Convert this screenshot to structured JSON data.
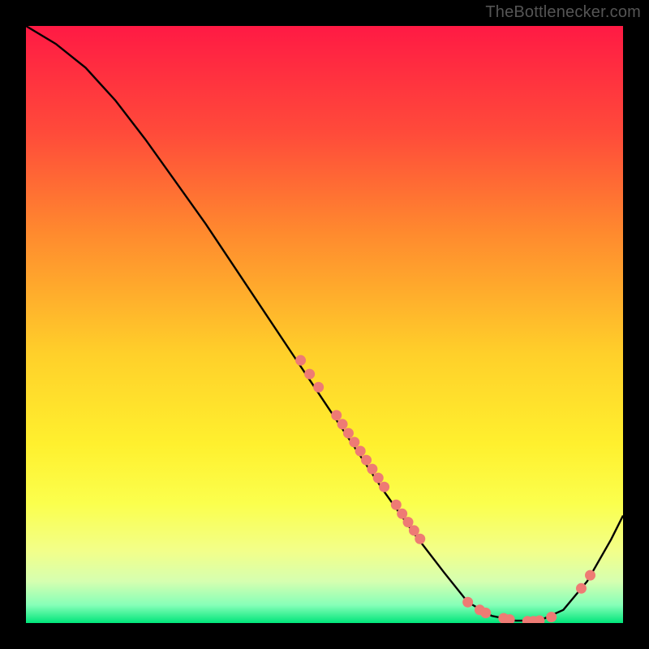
{
  "watermark": "TheBottlenecker.com",
  "chart_data": {
    "type": "line",
    "title": "",
    "xlabel": "",
    "ylabel": "",
    "xlim": [
      0,
      100
    ],
    "ylim": [
      0,
      100
    ],
    "background_gradient": {
      "stops": [
        {
          "offset": 0.0,
          "color": "#ff1a44"
        },
        {
          "offset": 0.18,
          "color": "#ff4b3a"
        },
        {
          "offset": 0.35,
          "color": "#ff8b2e"
        },
        {
          "offset": 0.55,
          "color": "#ffd02a"
        },
        {
          "offset": 0.7,
          "color": "#fff02e"
        },
        {
          "offset": 0.8,
          "color": "#fbff4d"
        },
        {
          "offset": 0.88,
          "color": "#f2ff8a"
        },
        {
          "offset": 0.93,
          "color": "#d6ffb0"
        },
        {
          "offset": 0.97,
          "color": "#86ffb8"
        },
        {
          "offset": 1.0,
          "color": "#00e57a"
        }
      ]
    },
    "curve": {
      "x": [
        0,
        5,
        10,
        15,
        20,
        25,
        30,
        35,
        40,
        45,
        50,
        55,
        60,
        65,
        70,
        74,
        78,
        82,
        86,
        90,
        94,
        98,
        100
      ],
      "y": [
        100,
        97,
        93,
        87.5,
        81,
        74,
        67,
        59.5,
        52,
        44.5,
        37,
        29.5,
        22,
        15,
        8.5,
        3.5,
        1.2,
        0.4,
        0.4,
        2.2,
        7,
        14,
        18
      ]
    },
    "points": [
      {
        "x": 46,
        "y": 44.0
      },
      {
        "x": 47.5,
        "y": 41.7
      },
      {
        "x": 49,
        "y": 39.5
      },
      {
        "x": 52,
        "y": 34.8
      },
      {
        "x": 53,
        "y": 33.3
      },
      {
        "x": 54,
        "y": 31.8
      },
      {
        "x": 55,
        "y": 30.3
      },
      {
        "x": 56,
        "y": 28.8
      },
      {
        "x": 57,
        "y": 27.3
      },
      {
        "x": 58,
        "y": 25.8
      },
      {
        "x": 59,
        "y": 24.3
      },
      {
        "x": 60,
        "y": 22.8
      },
      {
        "x": 62,
        "y": 19.8
      },
      {
        "x": 63,
        "y": 18.3
      },
      {
        "x": 64,
        "y": 16.9
      },
      {
        "x": 65,
        "y": 15.5
      },
      {
        "x": 66,
        "y": 14.1
      },
      {
        "x": 74,
        "y": 3.5
      },
      {
        "x": 76,
        "y": 2.2
      },
      {
        "x": 77,
        "y": 1.7
      },
      {
        "x": 80,
        "y": 0.8
      },
      {
        "x": 81,
        "y": 0.6
      },
      {
        "x": 84,
        "y": 0.3
      },
      {
        "x": 85,
        "y": 0.3
      },
      {
        "x": 86,
        "y": 0.4
      },
      {
        "x": 88,
        "y": 1.0
      },
      {
        "x": 93,
        "y": 5.8
      },
      {
        "x": 94.5,
        "y": 8.0
      }
    ],
    "point_color": "#ee7b74",
    "curve_color": "#000000"
  }
}
